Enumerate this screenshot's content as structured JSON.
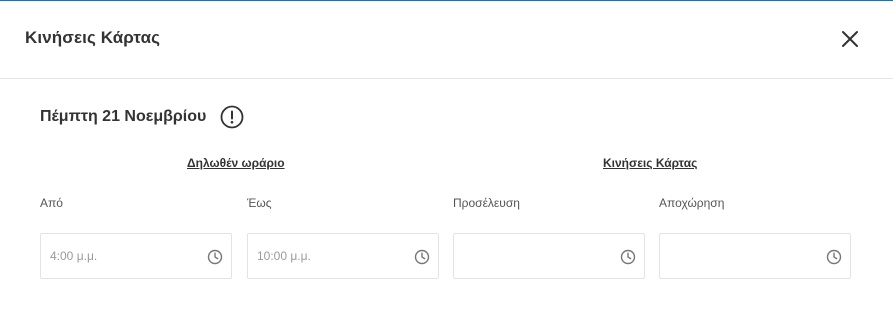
{
  "dialog": {
    "title": "Κινήσεις Κάρτας",
    "close_icon": "close-icon"
  },
  "date": {
    "title": "Πέμπτη 21 Νοεμβρίου",
    "info_icon": "info-icon"
  },
  "sections": {
    "declared_hours": "Δηλωθέν ωράριο",
    "card_movements": "Κινήσεις Κάρτας"
  },
  "fields": [
    {
      "label": "Από",
      "value": "4:00 μ.μ.",
      "icon": "clock-icon"
    },
    {
      "label": "Έως",
      "value": "10:00 μ.μ.",
      "icon": "clock-icon"
    },
    {
      "label": "Προσέλευση",
      "value": "",
      "icon": "clock-icon"
    },
    {
      "label": "Αποχώρηση",
      "value": "",
      "icon": "clock-icon"
    }
  ],
  "colors": {
    "text": "#333333",
    "placeholder": "#9a9a9a",
    "border": "#e3e3e3",
    "accent": "#2b6cb0"
  }
}
